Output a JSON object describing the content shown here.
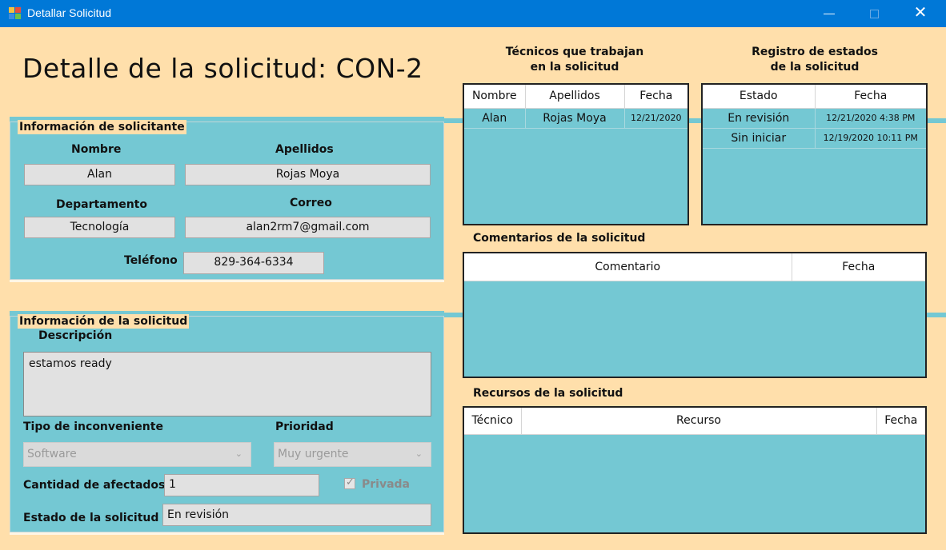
{
  "window": {
    "title": "Detallar Solicitud",
    "min_glyph": "—",
    "close_glyph": "✕"
  },
  "heading": "Detalle de la solicitud: CON-2",
  "applicant": {
    "legend": "Información de solicitante",
    "name_label": "Nombre",
    "name_value": "Alan",
    "last_label": "Apellidos",
    "last_value": "Rojas Moya",
    "dept_label": "Departamento",
    "dept_value": "Tecnología",
    "email_label": "Correo",
    "email_value": "alan2rm7@gmail.com",
    "phone_label": "Teléfono",
    "phone_value": "829-364-6334"
  },
  "request": {
    "legend": "Información de la solicitud",
    "desc_label": "Descripción",
    "desc_value": "estamos ready",
    "type_label": "Tipo de inconveniente",
    "type_value": "Software",
    "priority_label": "Prioridad",
    "priority_value": "Muy urgente",
    "affected_label": "Cantidad de afectados",
    "affected_value": "1",
    "private_label": "Privada",
    "private_checked": true,
    "status_label": "Estado de la solicitud",
    "status_value": "En revisión"
  },
  "technicians": {
    "title_line1": "Técnicos que trabajan",
    "title_line2": "en la solicitud",
    "columns": [
      "Nombre",
      "Apellidos",
      "Fecha"
    ],
    "rows": [
      [
        "Alan",
        "Rojas Moya",
        "12/21/2020"
      ]
    ]
  },
  "status_log": {
    "title_line1": "Registro de estados",
    "title_line2": "de la solicitud",
    "columns": [
      "Estado",
      "Fecha"
    ],
    "rows": [
      [
        "En revisión",
        "12/21/2020 4:38 PM"
      ],
      [
        "Sin iniciar",
        "12/19/2020 10:11 PM"
      ]
    ]
  },
  "comments": {
    "title": "Comentarios de la solicitud",
    "columns": [
      "Comentario",
      "Fecha"
    ],
    "rows": []
  },
  "resources": {
    "title": "Recursos de la solicitud",
    "columns": [
      "Técnico",
      "Recurso",
      "Fecha"
    ],
    "rows": []
  },
  "colors": {
    "background": "#ffdfab",
    "panel": "#74c8d3",
    "titlebar": "#0078d7"
  }
}
